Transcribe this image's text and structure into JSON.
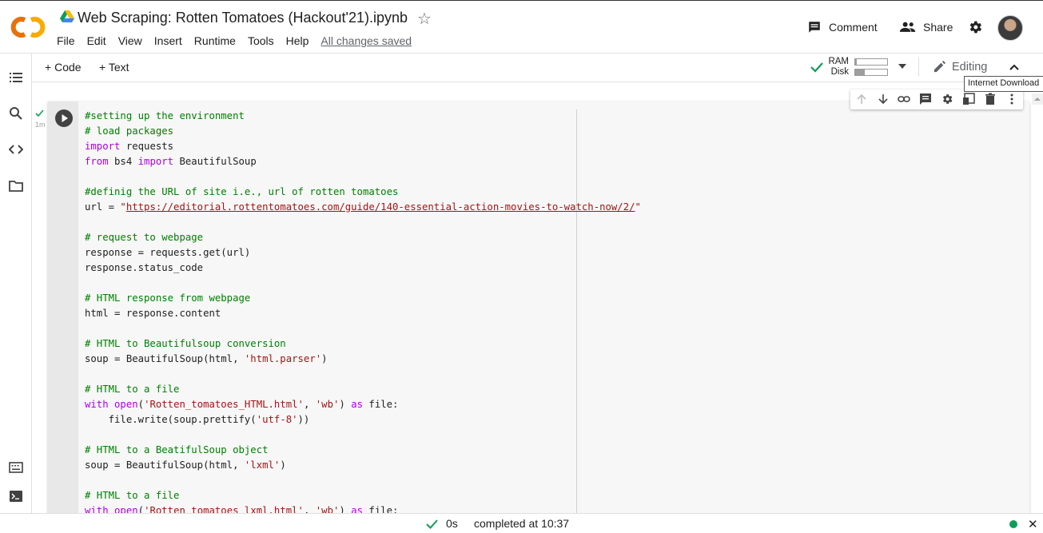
{
  "header": {
    "title": "Web Scraping: Rotten Tomatoes (Hackout'21).ipynb",
    "menu": [
      "File",
      "Edit",
      "View",
      "Insert",
      "Runtime",
      "Tools",
      "Help"
    ],
    "saved_status": "All changes saved",
    "comment_label": "Comment",
    "share_label": "Share"
  },
  "toolbar": {
    "code_label": "Code",
    "text_label": "Text",
    "ram_label": "RAM",
    "disk_label": "Disk",
    "ram_usage": 0.05,
    "disk_usage": 0.3,
    "editing_label": "Editing",
    "tooltip": "Internet Download"
  },
  "cell": {
    "exec_time": "1m",
    "lines": [
      [
        [
          "c-com",
          "#setting up the environment"
        ]
      ],
      [
        [
          "c-com",
          "# load packages"
        ]
      ],
      [
        [
          "c-kw",
          "import"
        ],
        [
          "c-txt",
          " requests"
        ]
      ],
      [
        [
          "c-kw",
          "from"
        ],
        [
          "c-txt",
          " bs4 "
        ],
        [
          "c-kw",
          "import"
        ],
        [
          "c-txt",
          " BeautifulSoup"
        ]
      ],
      [],
      [
        [
          "c-com",
          "#definig the URL of site i.e., url of rotten tomatoes"
        ]
      ],
      [
        [
          "c-txt",
          "url = "
        ],
        [
          "c-str",
          "\""
        ],
        [
          "c-url",
          "https://editorial.rottentomatoes.com/guide/140-essential-action-movies-to-watch-now/2/"
        ],
        [
          "c-str",
          "\""
        ]
      ],
      [],
      [
        [
          "c-com",
          "# request to webpage"
        ]
      ],
      [
        [
          "c-txt",
          "response = requests.get(url)"
        ]
      ],
      [
        [
          "c-txt",
          "response.status_code"
        ]
      ],
      [],
      [
        [
          "c-com",
          "# HTML response from webpage"
        ]
      ],
      [
        [
          "c-txt",
          "html = response.content"
        ]
      ],
      [],
      [
        [
          "c-com",
          "# HTML to Beautifulsoup conversion"
        ]
      ],
      [
        [
          "c-txt",
          "soup = BeautifulSoup(html, "
        ],
        [
          "c-str",
          "'html.parser'"
        ],
        [
          "c-txt",
          ")"
        ]
      ],
      [],
      [
        [
          "c-com",
          "# HTML to a file"
        ]
      ],
      [
        [
          "c-kw",
          "with"
        ],
        [
          "c-txt",
          " "
        ],
        [
          "c-kw",
          "open"
        ],
        [
          "c-txt",
          "("
        ],
        [
          "c-str",
          "'Rotten_tomatoes_HTML.html'"
        ],
        [
          "c-txt",
          ", "
        ],
        [
          "c-str",
          "'wb'"
        ],
        [
          "c-txt",
          ") "
        ],
        [
          "c-kw",
          "as"
        ],
        [
          "c-txt",
          " file:"
        ]
      ],
      [
        [
          "c-txt",
          "    file.write(soup.prettify("
        ],
        [
          "c-str",
          "'utf-8'"
        ],
        [
          "c-txt",
          "))"
        ]
      ],
      [],
      [
        [
          "c-com",
          "# HTML to a BeatifulSoup object"
        ]
      ],
      [
        [
          "c-txt",
          "soup = BeautifulSoup(html, "
        ],
        [
          "c-str",
          "'lxml'"
        ],
        [
          "c-txt",
          ")"
        ]
      ],
      [],
      [
        [
          "c-com",
          "# HTML to a file"
        ]
      ],
      [
        [
          "c-kw",
          "with"
        ],
        [
          "c-txt",
          " "
        ],
        [
          "c-kw",
          "open"
        ],
        [
          "c-txt",
          "("
        ],
        [
          "c-str",
          "'Rotten_tomatoes_lxml.html'"
        ],
        [
          "c-txt",
          ", "
        ],
        [
          "c-str",
          "'wb'"
        ],
        [
          "c-txt",
          ") "
        ],
        [
          "c-kw",
          "as"
        ],
        [
          "c-txt",
          " file:"
        ]
      ]
    ]
  },
  "status": {
    "duration": "0s",
    "completed": "completed at 10:37"
  },
  "colors": {
    "accent_green": "#0f9d58",
    "logo_orange": "#f9ab00",
    "logo_dark_orange": "#e8710a",
    "comment_green": "#008000",
    "keyword_purple": "#af00db",
    "string_red": "#a31515"
  }
}
